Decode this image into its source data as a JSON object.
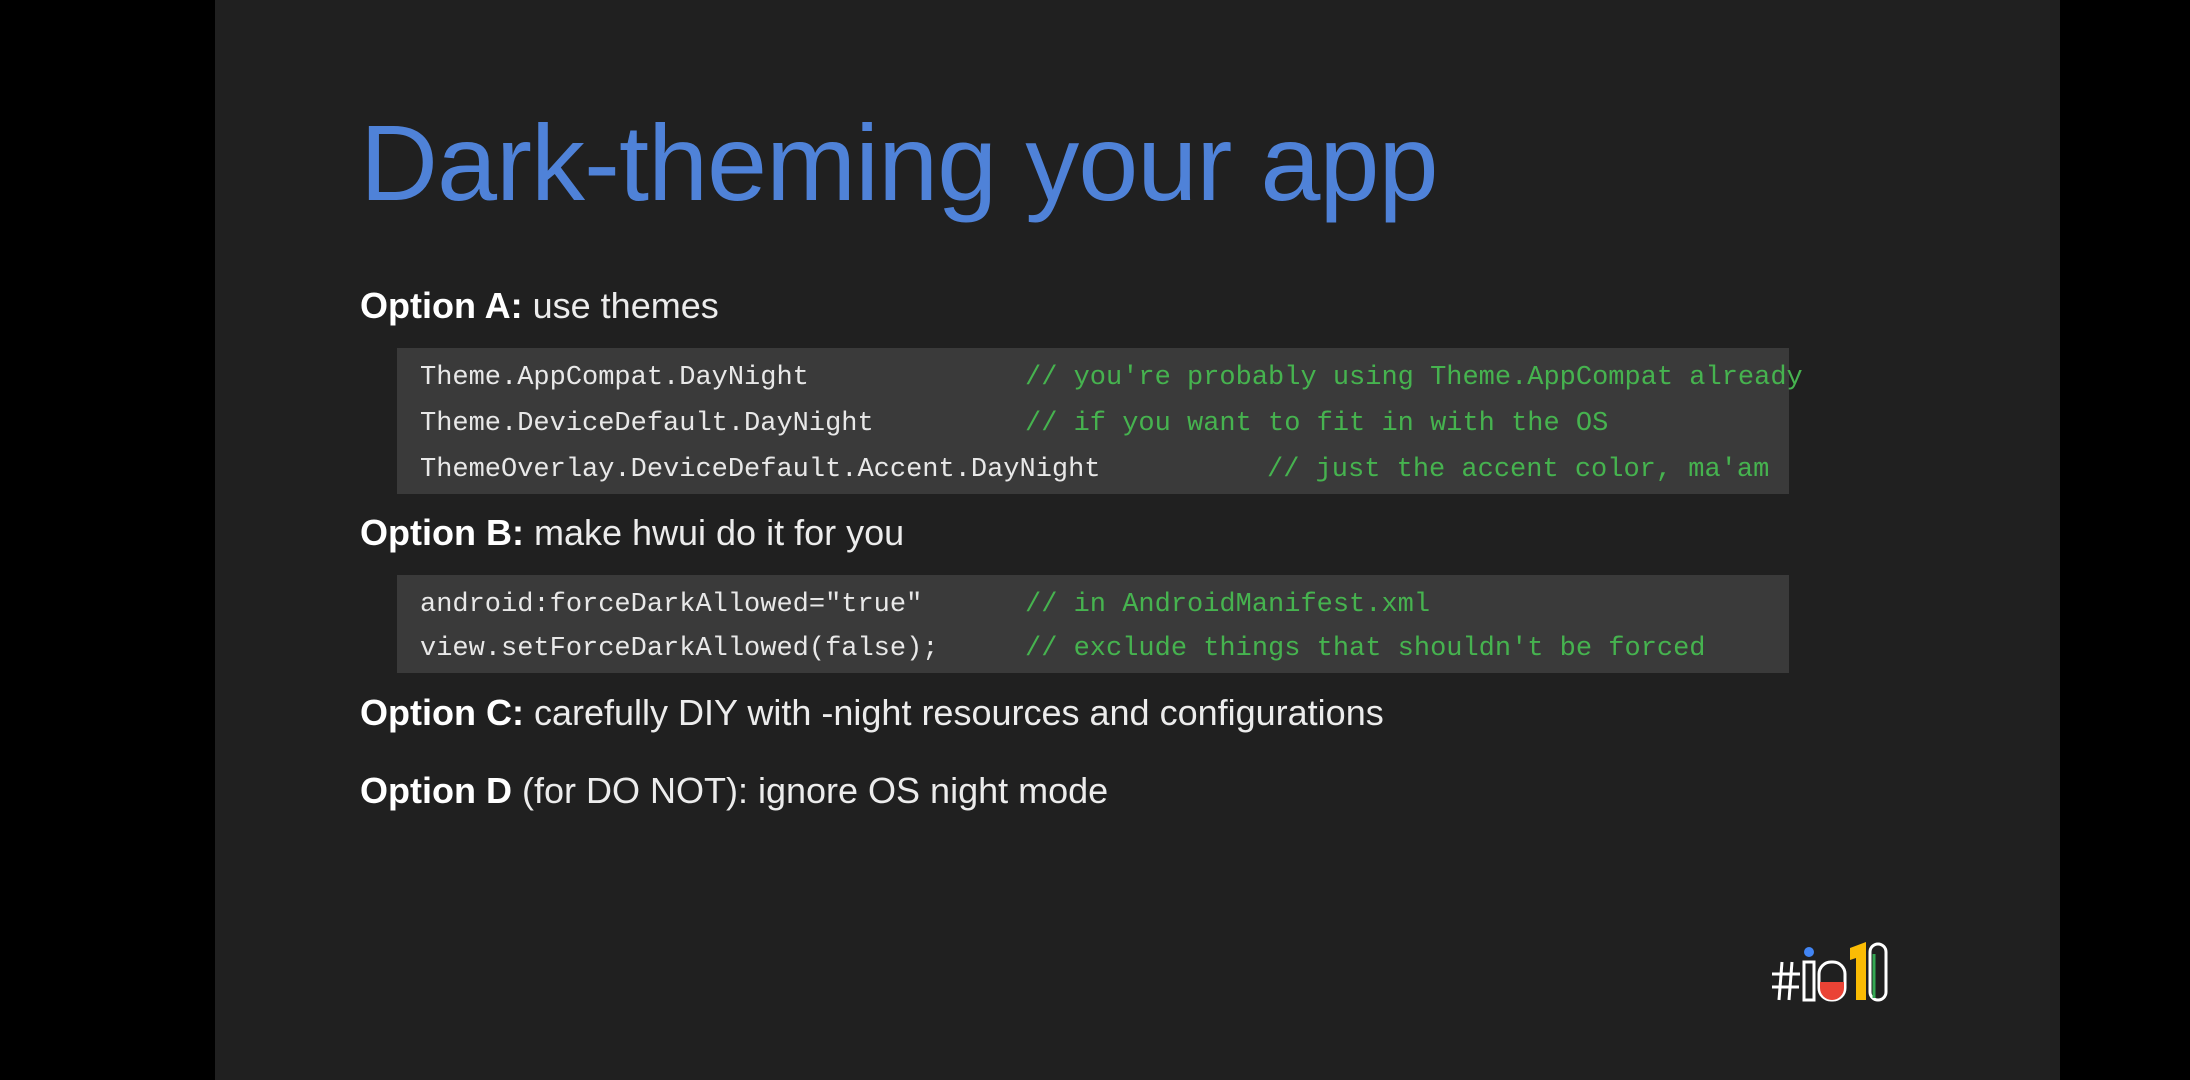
{
  "slide": {
    "title": "Dark-theming your app"
  },
  "options": {
    "a": {
      "label": "Option A:",
      "text": " use themes"
    },
    "b": {
      "label": "Option B:",
      "text": " make hwui do it for you"
    },
    "c": {
      "label": "Option C:",
      "text": " carefully DIY with -night resources and configurations"
    },
    "d": {
      "label": "Option D",
      "text": " (for DO NOT): ignore OS night mode"
    }
  },
  "code_a": [
    {
      "code": "Theme.AppCompat.DayNight",
      "comment": "// you're probably using Theme.AppCompat already"
    },
    {
      "code": "Theme.DeviceDefault.DayNight",
      "comment": "// if you want to fit in with the OS"
    },
    {
      "code": "ThemeOverlay.DeviceDefault.Accent.DayNight",
      "comment": "// just the accent color, ma'am"
    }
  ],
  "code_b": [
    {
      "code": "android:forceDarkAllowed=\"true\"",
      "comment": "// in AndroidManifest.xml"
    },
    {
      "code": "view.setForceDarkAllowed(false);",
      "comment": "// exclude things that shouldn't be forced"
    }
  ],
  "logo": {
    "text": "#io19",
    "icon": "google-io-19-logo-icon",
    "colors": {
      "blue": "#4285f4",
      "red": "#ea4335",
      "yellow": "#fbbc04",
      "green": "#34a853"
    }
  },
  "colors": {
    "title": "#4f82d8",
    "comment": "#46b34f",
    "slide_bg": "#202020",
    "code_bg": "#3a3a3a"
  }
}
